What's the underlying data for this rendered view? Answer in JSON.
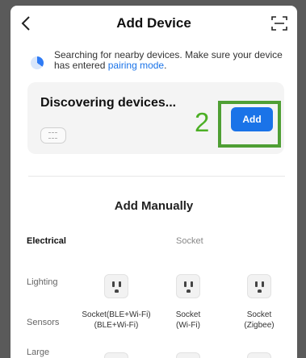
{
  "header": {
    "title": "Add Device",
    "back_icon": "chevron-left-icon",
    "scan_icon": "scan-icon"
  },
  "banner": {
    "text": "Searching for nearby devices. Make sure your device has entered ",
    "link": "pairing mode",
    "suffix": "."
  },
  "discover": {
    "title": "Discovering devices...",
    "annotation_number": "2",
    "add_label": "Add"
  },
  "manual": {
    "title": "Add Manually"
  },
  "categories": [
    "Electrical",
    "Lighting",
    "Sensors",
    "Large"
  ],
  "subcategory": "Socket",
  "devices": [
    {
      "name": "Socket(BLE+Wi-Fi)",
      "sub": "(BLE+Wi-Fi)"
    },
    {
      "name": "Socket",
      "sub": "(Wi-Fi)"
    },
    {
      "name": "Socket",
      "sub": "(Zigbee)"
    }
  ],
  "colors": {
    "accent": "#1a73e8",
    "highlight": "#4f9f34"
  }
}
